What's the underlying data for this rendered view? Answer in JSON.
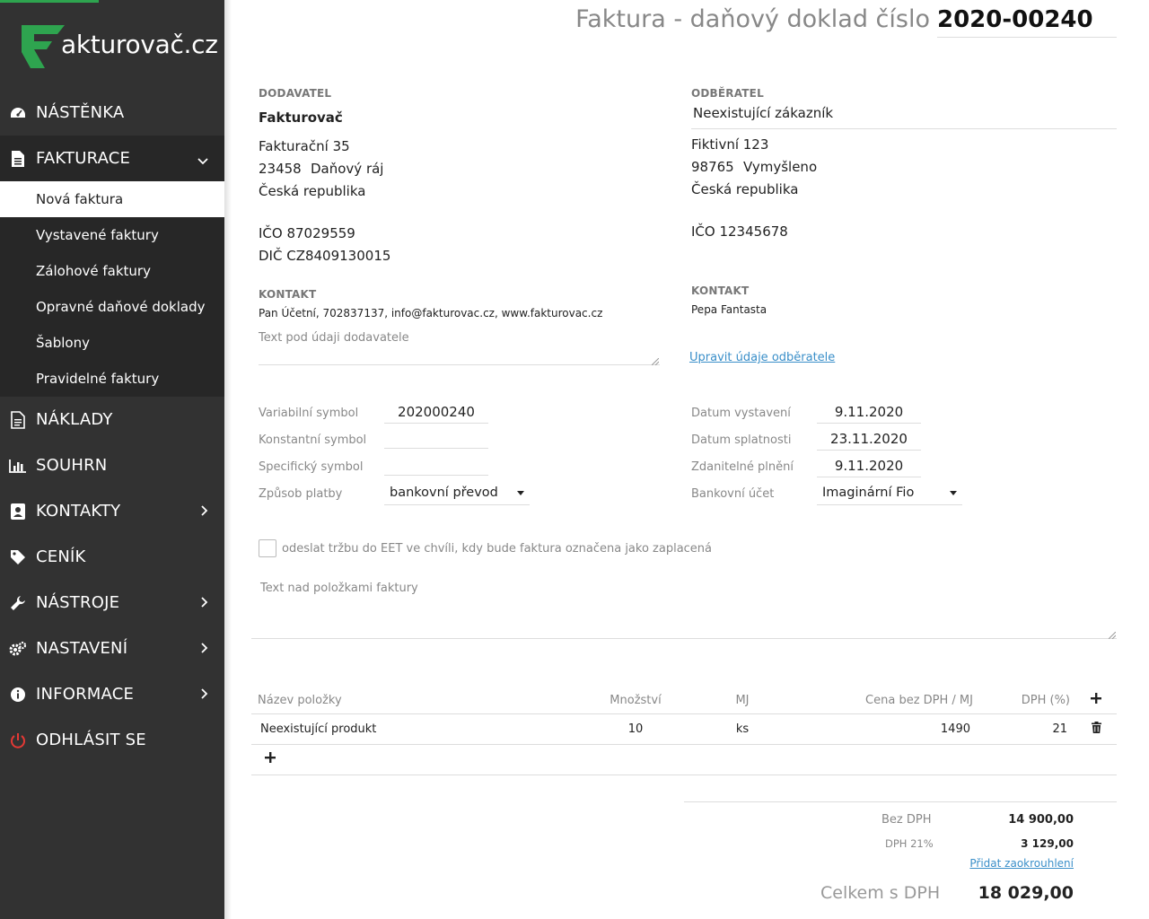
{
  "brand": {
    "name": "akturovač.cz",
    "accent": "#2ea44f"
  },
  "sidebar": {
    "items": [
      {
        "key": "nastenka",
        "label": "NÁSTĚNKA",
        "icon": "dashboard-icon"
      },
      {
        "key": "fakturace",
        "label": "FAKTURACE",
        "icon": "document-icon",
        "expanded": true
      },
      {
        "key": "naklady",
        "label": "NÁKLADY",
        "icon": "receipt-icon"
      },
      {
        "key": "souhrn",
        "label": "SOUHRN",
        "icon": "bar-chart-icon"
      },
      {
        "key": "kontakty",
        "label": "KONTAKTY",
        "icon": "contact-card-icon"
      },
      {
        "key": "cenik",
        "label": "CENÍK",
        "icon": "price-tag-icon"
      },
      {
        "key": "nastroje",
        "label": "NÁSTROJE",
        "icon": "wrench-icon"
      },
      {
        "key": "nastaveni",
        "label": "NASTAVENÍ",
        "icon": "gears-icon"
      },
      {
        "key": "informace",
        "label": "INFORMACE",
        "icon": "info-icon"
      },
      {
        "key": "odhlasit",
        "label": "ODHLÁSIT SE",
        "icon": "power-icon"
      }
    ],
    "fakturace_sub": [
      "Nová faktura",
      "Vystavené faktury",
      "Zálohové faktury",
      "Opravné daňové doklady",
      "Šablony",
      "Pravidelné faktury"
    ]
  },
  "header": {
    "title": "Faktura - daňový doklad číslo",
    "number": "2020-00240"
  },
  "supplier": {
    "heading": "DODAVATEL",
    "name": "Fakturovač",
    "street": "Fakturační 35",
    "zip": "23458",
    "city": "Daňový ráj",
    "country": "Česká republika",
    "ico": "IČO 87029559",
    "dic": "DIČ CZ8409130015",
    "contact_heading": "KONTAKT",
    "contact": "Pan Účetní, 702837137, info@fakturovac.cz, www.fakturovac.cz",
    "note_placeholder": "Text pod údaji dodavatele"
  },
  "customer": {
    "heading": "ODBĚRATEL",
    "name": "Neexistující zákazník",
    "street": "Fiktivní 123",
    "zip": "98765",
    "city": "Vymyšleno",
    "country": "Česká republika",
    "ico": "IČO 12345678",
    "contact_heading": "KONTAKT",
    "contact": "Pepa Fantasta",
    "edit_link": "Upravit údaje odběratele"
  },
  "payment": {
    "vs_label": "Variabilní symbol",
    "vs": "202000240",
    "ks_label": "Konstantní symbol",
    "ks": "",
    "ss_label": "Specifický symbol",
    "ss": "",
    "method_label": "Způsob platby",
    "method": "bankovní převod",
    "issued_label": "Datum vystavení",
    "issued": "9.11.2020",
    "due_label": "Datum splatnosti",
    "due": "23.11.2020",
    "taxable_label": "Zdanitelné plnění",
    "taxable": "9.11.2020",
    "account_label": "Bankovní účet",
    "account": "Imaginární Fio"
  },
  "eet_label": "odeslat tržbu do EET ve chvíli, kdy bude faktura označena jako zaplacená",
  "items_note_placeholder": "Text nad položkami faktury",
  "items": {
    "headers": [
      "Název položky",
      "Množství",
      "MJ",
      "Cena bez DPH / MJ",
      "DPH (%)"
    ],
    "rows": [
      {
        "name": "Neexistující produkt",
        "qty": "10",
        "unit": "ks",
        "price": "1490",
        "vat": "21"
      }
    ]
  },
  "totals": {
    "net_label": "Bez DPH",
    "net": "14 900,00",
    "vat_label": "DPH 21%",
    "vat": "3 129,00",
    "rounding_link": "Přidat zaokrouhlení",
    "total_label": "Celkem s DPH",
    "total": "18 029,00"
  }
}
